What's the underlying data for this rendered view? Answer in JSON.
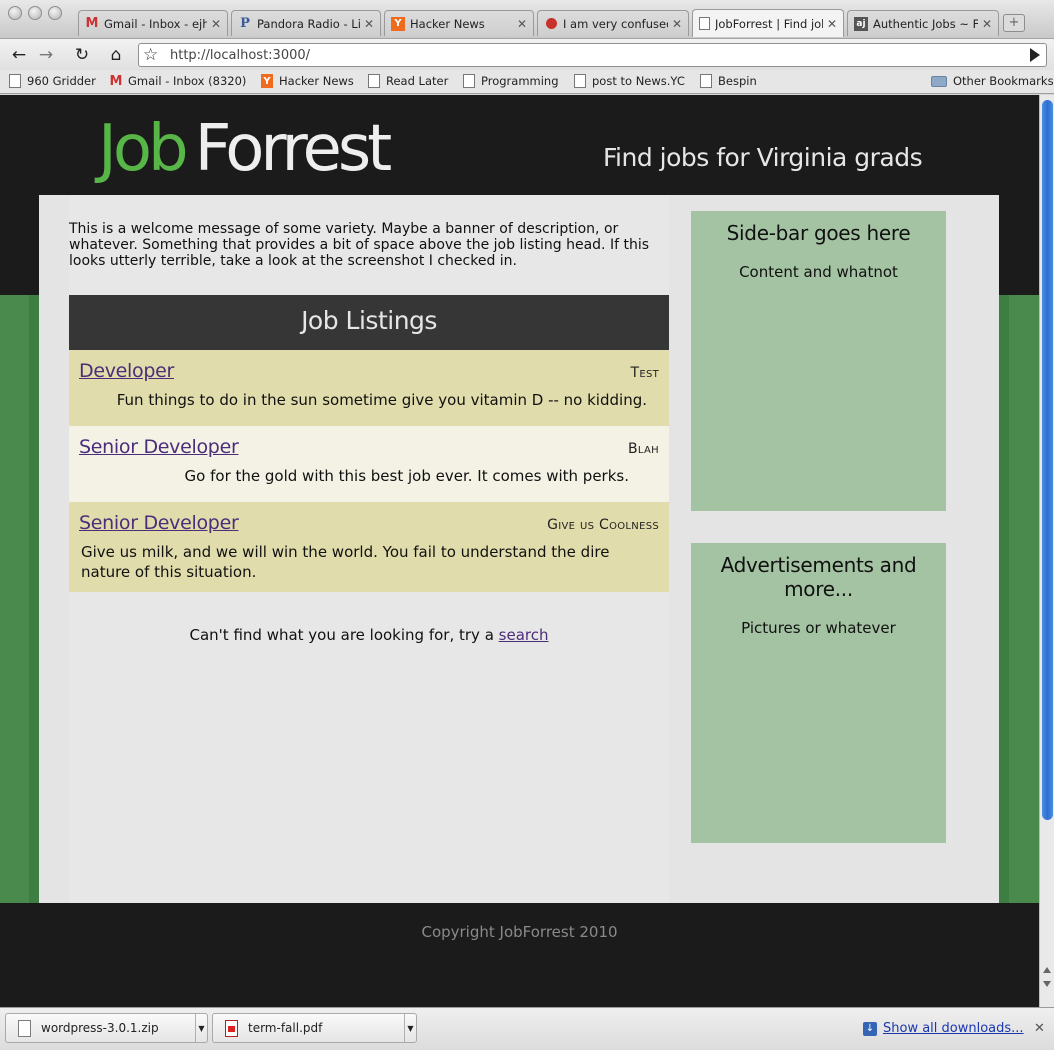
{
  "browser": {
    "tabs": [
      {
        "label": "Gmail - Inbox - ejh",
        "icon": "gmail-icon",
        "active": false
      },
      {
        "label": "Pandora Radio - List",
        "icon": "pandora-icon",
        "active": false
      },
      {
        "label": "Hacker News",
        "icon": "hacker-news-icon",
        "active": false
      },
      {
        "label": "I am very confused",
        "icon": "site-icon",
        "active": false
      },
      {
        "label": "JobForrest | Find job",
        "icon": "page-icon",
        "active": true
      },
      {
        "label": "Authentic Jobs ~ Ful",
        "icon": "authentic-jobs-icon",
        "active": false
      }
    ],
    "url": "http://localhost:3000/",
    "bookmarks": [
      {
        "label": "960 Gridder",
        "icon": "page-icon"
      },
      {
        "label": "Gmail - Inbox (8320)",
        "icon": "gmail-icon"
      },
      {
        "label": "Hacker News",
        "icon": "hacker-news-icon"
      },
      {
        "label": "Read Later",
        "icon": "page-icon"
      },
      {
        "label": "Programming",
        "icon": "page-icon"
      },
      {
        "label": "post to News.YC",
        "icon": "page-icon"
      },
      {
        "label": "Bespin",
        "icon": "page-icon"
      }
    ],
    "other_bookmarks": "Other Bookmarks",
    "downloads": [
      {
        "filename": "wordpress-3.0.1.zip"
      },
      {
        "filename": "term-fall.pdf"
      }
    ],
    "show_all_downloads": "Show all downloads..."
  },
  "site": {
    "logo_job": "Job",
    "logo_forrest": "Forrest",
    "tagline": "Find jobs for Virginia grads",
    "welcome": "This is a welcome message of some variety. Maybe a banner of description, or whatever. Something that provides a bit of space above the job listing head. If this looks utterly terrible, take a look at the screenshot I checked in.",
    "listings_title": "Job Listings",
    "jobs": [
      {
        "title": "Developer",
        "company": "Test",
        "description": "Fun things to do in the sun sometime give you vitamin D -- no kidding."
      },
      {
        "title": "Senior Developer",
        "company": "Blah",
        "description": "Go for the gold with this best job ever. It comes with perks."
      },
      {
        "title": "Senior Developer",
        "company": "Give us Coolness",
        "description": "Give us milk, and we will win the world. You fail to understand the dire nature of this situation."
      }
    ],
    "not_found_text": "Can't find what you are looking for, try a",
    "search_link": "search",
    "sidebar": {
      "title": "Side-bar goes here",
      "content": "Content and whatnot"
    },
    "ads": {
      "title": "Advertisements and more...",
      "content": "Pictures or whatever"
    },
    "footer": "Copyright JobForrest 2010"
  },
  "colors": {
    "logo_green": "#58b547",
    "band_green": "#4a8a4c",
    "sidebar_green": "#a3c3a3",
    "row_yellow": "#e1dcab",
    "row_cream": "#f4f2e5",
    "link_purple": "#4b2d7a"
  }
}
